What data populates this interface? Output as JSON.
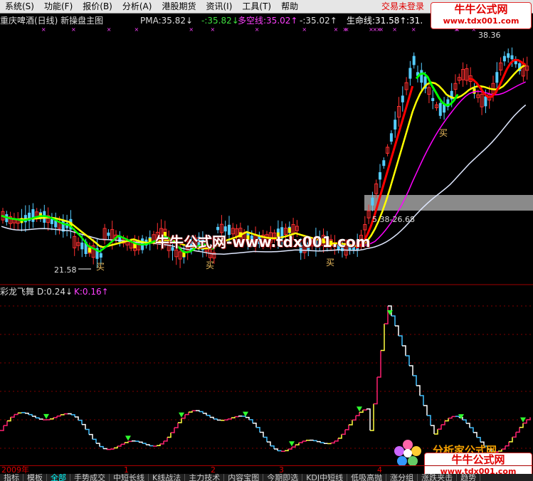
{
  "menu": [
    {
      "label": "系统(S)"
    },
    {
      "label": "功能(F)"
    },
    {
      "label": "报价(B)"
    },
    {
      "label": "分析(A)"
    },
    {
      "label": "港股期货"
    },
    {
      "label": "资讯(I)"
    },
    {
      "label": "工具(T)"
    },
    {
      "label": "帮助"
    }
  ],
  "status": {
    "login": "交易未登录"
  },
  "watermark": {
    "title": "牛牛公式网",
    "url": "www.tdx001.com",
    "center": "牛牛公式网-www.tdx001.com",
    "bottom_cn": "分析家公式网"
  },
  "main_panel": {
    "title": "重庆啤酒(日线) 新操盘主图",
    "pma_label": "PMA:35.82↓",
    "pma_val2": "-:35.82↓",
    "duokong_label": "多空线:35.02↑",
    "duokong_val2": "-:35.02↑",
    "life_label": "生命线:31.58↑",
    "life_val2": ":31."
  },
  "price_labels": {
    "low_left": "21.58",
    "top_right": "38.36",
    "mid_right": "5.38-26.68"
  },
  "buy_label": "买",
  "sub_panel": {
    "title": "彩龙飞舞",
    "d_label": "D:0.24↓",
    "k_label": "K:0.16↑"
  },
  "date_axis": [
    {
      "label": "2009年"
    },
    {
      "label": "1"
    },
    {
      "label": "2"
    },
    {
      "label": "3"
    },
    {
      "label": "4"
    }
  ],
  "tabs": [
    {
      "label": "指标"
    },
    {
      "label": "模板"
    },
    {
      "label": "全部"
    },
    {
      "label": "手势成交"
    },
    {
      "label": "中短长线"
    },
    {
      "label": "K线战法"
    },
    {
      "label": "主力技术"
    },
    {
      "label": "内容宝图"
    },
    {
      "label": "今期即选"
    },
    {
      "label": "KDJ中短线"
    },
    {
      "label": "低吸高抛"
    },
    {
      "label": "涨分组"
    },
    {
      "label": "涨跌夹击"
    },
    {
      "label": "趋势"
    }
  ],
  "colors": {
    "up": "#ff3030",
    "down": "#55ccff",
    "yellow_line": "#ffff00",
    "green_line": "#00ff00",
    "magenta_line": "#ff00ff",
    "white_line": "#e0e8ff",
    "red_line": "#ff0000"
  }
}
